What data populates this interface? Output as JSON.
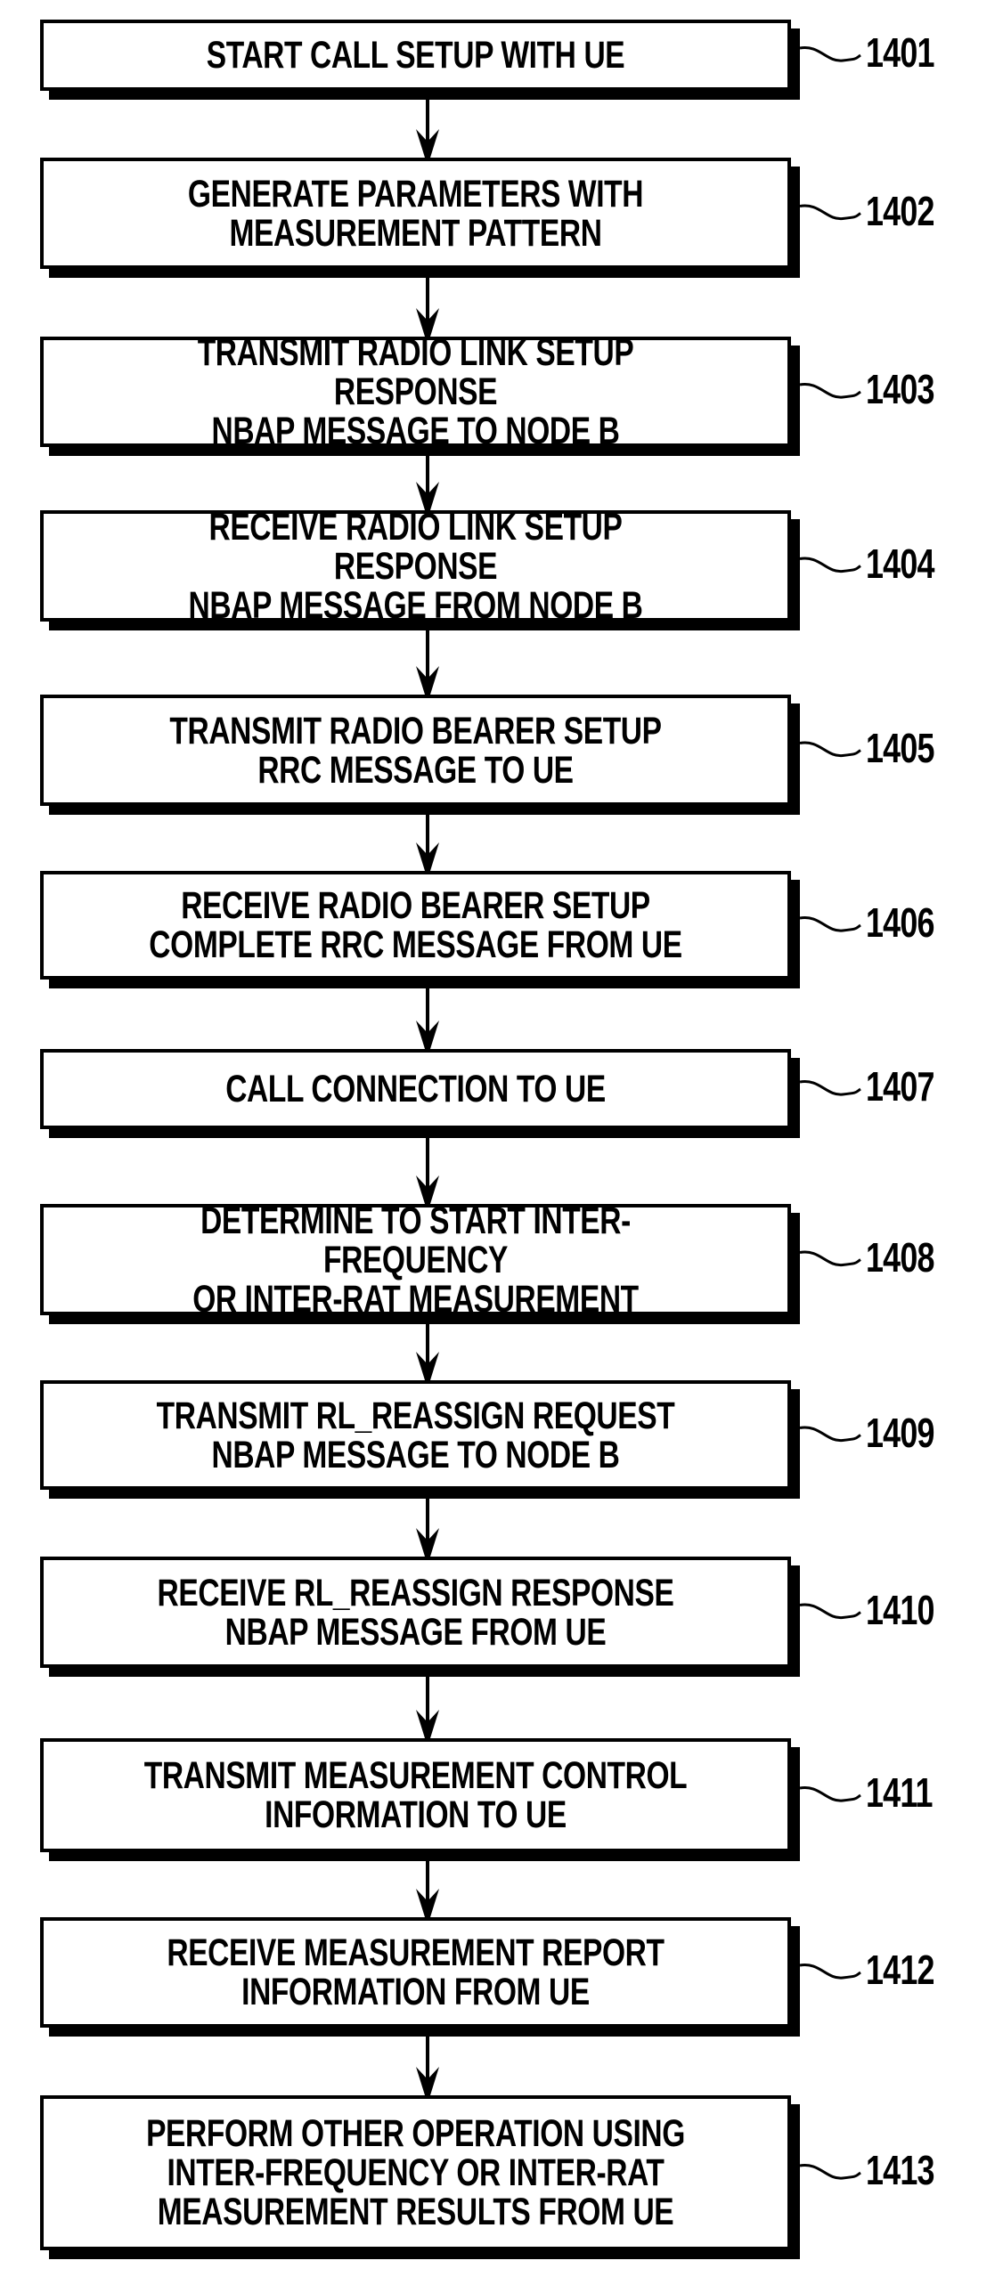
{
  "figure": {
    "steps": [
      {
        "id": "1401",
        "text": "START CALL SETUP WITH UE"
      },
      {
        "id": "1402",
        "text": "GENERATE PARAMETERS WITH\nMEASUREMENT PATTERN"
      },
      {
        "id": "1403",
        "text": "TRANSMIT RADIO LINK SETUP RESPONSE\nNBAP MESSAGE TO NODE B"
      },
      {
        "id": "1404",
        "text": "RECEIVE RADIO LINK SETUP RESPONSE\nNBAP MESSAGE FROM NODE B"
      },
      {
        "id": "1405",
        "text": "TRANSMIT RADIO BEARER SETUP\nRRC MESSAGE TO UE"
      },
      {
        "id": "1406",
        "text": "RECEIVE RADIO BEARER SETUP\nCOMPLETE RRC MESSAGE FROM UE"
      },
      {
        "id": "1407",
        "text": "CALL CONNECTION TO UE"
      },
      {
        "id": "1408",
        "text": "DETERMINE TO START INTER-FREQUENCY\nOR INTER-RAT MEASUREMENT"
      },
      {
        "id": "1409",
        "text": "TRANSMIT RL_REASSIGN REQUEST\nNBAP MESSAGE TO NODE B"
      },
      {
        "id": "1410",
        "text": "RECEIVE RL_REASSIGN RESPONSE\nNBAP MESSAGE FROM UE"
      },
      {
        "id": "1411",
        "text": "TRANSMIT MEASUREMENT CONTROL\nINFORMATION TO UE"
      },
      {
        "id": "1412",
        "text": "RECEIVE MEASUREMENT REPORT\nINFORMATION FROM UE"
      },
      {
        "id": "1413",
        "text": "PERFORM OTHER OPERATION USING\nINTER-FREQUENCY OR INTER-RAT\nMEASUREMENT RESULTS FROM UE"
      }
    ],
    "flow": [
      [
        "1401",
        "1402"
      ],
      [
        "1402",
        "1403"
      ],
      [
        "1403",
        "1404"
      ],
      [
        "1404",
        "1405"
      ],
      [
        "1405",
        "1406"
      ],
      [
        "1406",
        "1407"
      ],
      [
        "1407",
        "1408"
      ],
      [
        "1408",
        "1409"
      ],
      [
        "1409",
        "1410"
      ],
      [
        "1410",
        "1411"
      ],
      [
        "1411",
        "1412"
      ],
      [
        "1412",
        "1413"
      ]
    ],
    "colors": {
      "ink": "#000000",
      "paper": "#ffffff"
    }
  }
}
